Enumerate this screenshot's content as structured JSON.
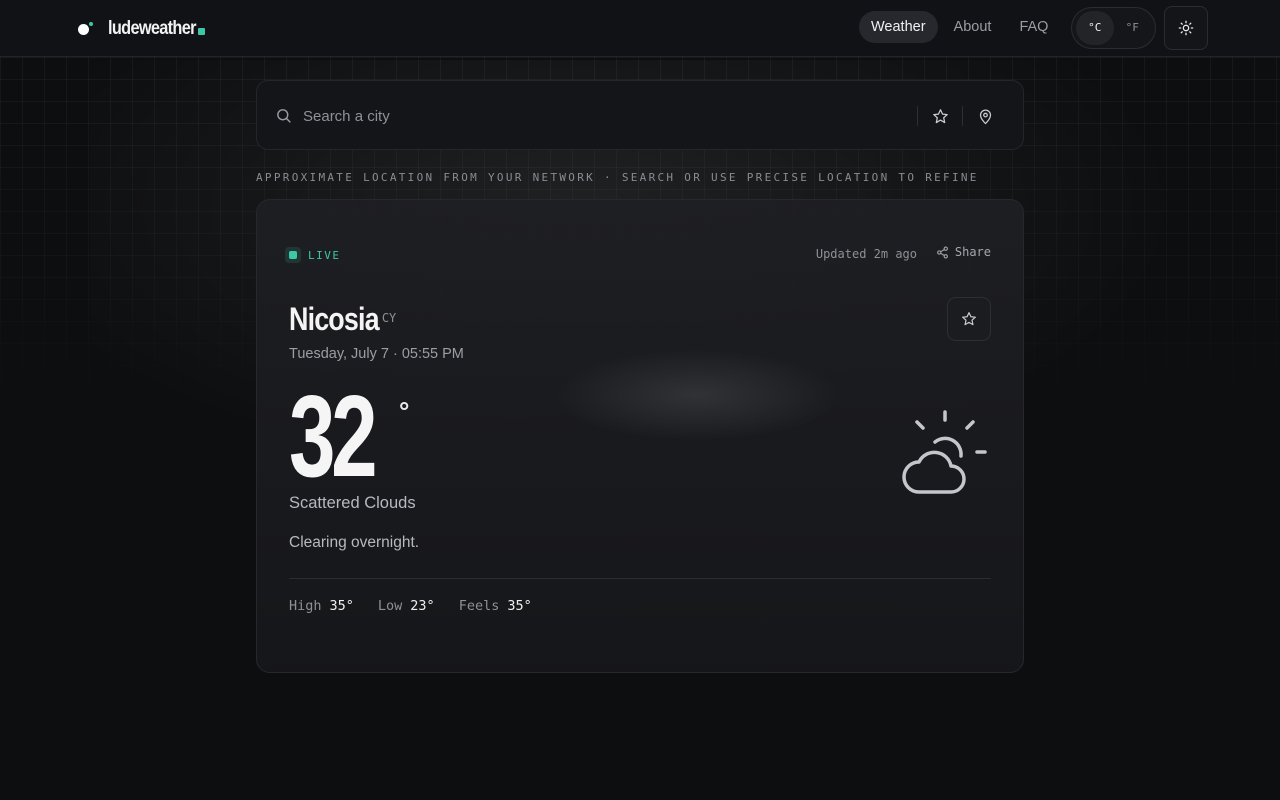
{
  "brand": {
    "name": "ludeweather"
  },
  "nav": {
    "items": [
      {
        "label": "Weather",
        "active": true
      },
      {
        "label": "About"
      },
      {
        "label": "FAQ"
      }
    ]
  },
  "units": {
    "celsius": "°C",
    "fahrenheit": "°F",
    "selected": "°C"
  },
  "search": {
    "placeholder": "Search a city"
  },
  "hint": "APPROXIMATE LOCATION FROM YOUR NETWORK · SEARCH OR USE PRECISE LOCATION TO REFINE",
  "card": {
    "live_label": "LIVE",
    "updated": "Updated 2m ago",
    "share_label": "Share",
    "city": "Nicosia",
    "country": "CY",
    "date": "Tuesday, July 7 · 05:55 PM",
    "temperature": "32",
    "degree_symbol": "°",
    "condition": "Scattered Clouds",
    "summary": "Clearing overnight.",
    "stats": [
      {
        "label": "High",
        "value": "35°"
      },
      {
        "label": "Low",
        "value": "23°"
      },
      {
        "label": "Feels",
        "value": "35°"
      }
    ]
  },
  "icons": {
    "search": "search-icon",
    "favorites": "star-icon",
    "location": "map-pin-icon",
    "theme": "sun-icon",
    "share": "share-icon",
    "weather": "partly-cloudy-icon"
  },
  "colors": {
    "accent": "#3ec7a6",
    "background": "#0d0e10",
    "card": "#1b1c20"
  }
}
